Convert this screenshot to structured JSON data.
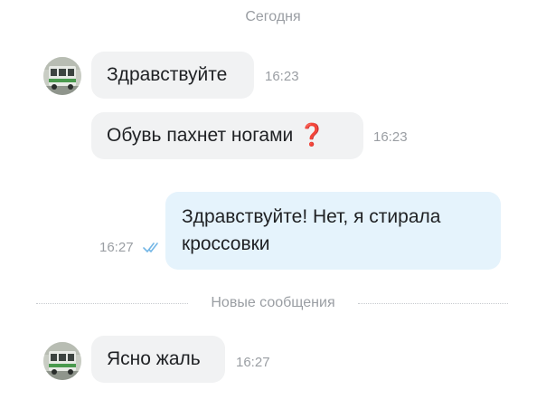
{
  "chat": {
    "date_separator": "Сегодня",
    "new_messages_separator": "Новые сообщения",
    "messages": [
      {
        "direction": "incoming",
        "text": "Здравствуйте",
        "time": "16:23"
      },
      {
        "direction": "incoming",
        "text": "Обувь пахнет ногами",
        "icon": "red-question-mark-icon",
        "icon_glyph": "❓",
        "time": "16:23"
      },
      {
        "direction": "outgoing",
        "text_line1": "Здравствуйте! Нет, я стирала",
        "text_line2": "кроссовки",
        "time": "16:27",
        "status": "read"
      },
      {
        "direction": "incoming",
        "text": "Ясно жаль",
        "time": "16:27"
      }
    ]
  },
  "colors": {
    "incoming_bubble": "#f1f2f3",
    "outgoing_bubble": "#e5f3fc",
    "read_checks": "#74b7e6",
    "question_icon": "#d33a3a"
  }
}
